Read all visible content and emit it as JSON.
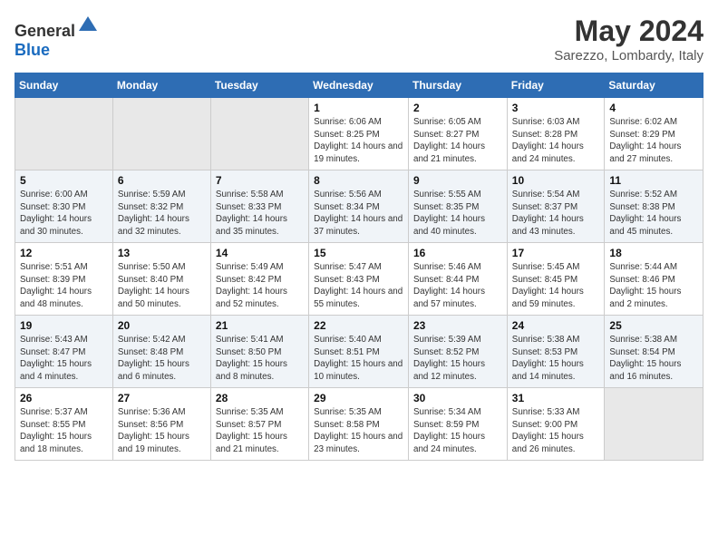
{
  "header": {
    "logo_general": "General",
    "logo_blue": "Blue",
    "title": "May 2024",
    "subtitle": "Sarezzo, Lombardy, Italy"
  },
  "weekdays": [
    "Sunday",
    "Monday",
    "Tuesday",
    "Wednesday",
    "Thursday",
    "Friday",
    "Saturday"
  ],
  "weeks": [
    [
      {
        "day": "",
        "info": ""
      },
      {
        "day": "",
        "info": ""
      },
      {
        "day": "",
        "info": ""
      },
      {
        "day": "1",
        "info": "Sunrise: 6:06 AM\nSunset: 8:25 PM\nDaylight: 14 hours\nand 19 minutes."
      },
      {
        "day": "2",
        "info": "Sunrise: 6:05 AM\nSunset: 8:27 PM\nDaylight: 14 hours\nand 21 minutes."
      },
      {
        "day": "3",
        "info": "Sunrise: 6:03 AM\nSunset: 8:28 PM\nDaylight: 14 hours\nand 24 minutes."
      },
      {
        "day": "4",
        "info": "Sunrise: 6:02 AM\nSunset: 8:29 PM\nDaylight: 14 hours\nand 27 minutes."
      }
    ],
    [
      {
        "day": "5",
        "info": "Sunrise: 6:00 AM\nSunset: 8:30 PM\nDaylight: 14 hours\nand 30 minutes."
      },
      {
        "day": "6",
        "info": "Sunrise: 5:59 AM\nSunset: 8:32 PM\nDaylight: 14 hours\nand 32 minutes."
      },
      {
        "day": "7",
        "info": "Sunrise: 5:58 AM\nSunset: 8:33 PM\nDaylight: 14 hours\nand 35 minutes."
      },
      {
        "day": "8",
        "info": "Sunrise: 5:56 AM\nSunset: 8:34 PM\nDaylight: 14 hours\nand 37 minutes."
      },
      {
        "day": "9",
        "info": "Sunrise: 5:55 AM\nSunset: 8:35 PM\nDaylight: 14 hours\nand 40 minutes."
      },
      {
        "day": "10",
        "info": "Sunrise: 5:54 AM\nSunset: 8:37 PM\nDaylight: 14 hours\nand 43 minutes."
      },
      {
        "day": "11",
        "info": "Sunrise: 5:52 AM\nSunset: 8:38 PM\nDaylight: 14 hours\nand 45 minutes."
      }
    ],
    [
      {
        "day": "12",
        "info": "Sunrise: 5:51 AM\nSunset: 8:39 PM\nDaylight: 14 hours\nand 48 minutes."
      },
      {
        "day": "13",
        "info": "Sunrise: 5:50 AM\nSunset: 8:40 PM\nDaylight: 14 hours\nand 50 minutes."
      },
      {
        "day": "14",
        "info": "Sunrise: 5:49 AM\nSunset: 8:42 PM\nDaylight: 14 hours\nand 52 minutes."
      },
      {
        "day": "15",
        "info": "Sunrise: 5:47 AM\nSunset: 8:43 PM\nDaylight: 14 hours\nand 55 minutes."
      },
      {
        "day": "16",
        "info": "Sunrise: 5:46 AM\nSunset: 8:44 PM\nDaylight: 14 hours\nand 57 minutes."
      },
      {
        "day": "17",
        "info": "Sunrise: 5:45 AM\nSunset: 8:45 PM\nDaylight: 14 hours\nand 59 minutes."
      },
      {
        "day": "18",
        "info": "Sunrise: 5:44 AM\nSunset: 8:46 PM\nDaylight: 15 hours\nand 2 minutes."
      }
    ],
    [
      {
        "day": "19",
        "info": "Sunrise: 5:43 AM\nSunset: 8:47 PM\nDaylight: 15 hours\nand 4 minutes."
      },
      {
        "day": "20",
        "info": "Sunrise: 5:42 AM\nSunset: 8:48 PM\nDaylight: 15 hours\nand 6 minutes."
      },
      {
        "day": "21",
        "info": "Sunrise: 5:41 AM\nSunset: 8:50 PM\nDaylight: 15 hours\nand 8 minutes."
      },
      {
        "day": "22",
        "info": "Sunrise: 5:40 AM\nSunset: 8:51 PM\nDaylight: 15 hours\nand 10 minutes."
      },
      {
        "day": "23",
        "info": "Sunrise: 5:39 AM\nSunset: 8:52 PM\nDaylight: 15 hours\nand 12 minutes."
      },
      {
        "day": "24",
        "info": "Sunrise: 5:38 AM\nSunset: 8:53 PM\nDaylight: 15 hours\nand 14 minutes."
      },
      {
        "day": "25",
        "info": "Sunrise: 5:38 AM\nSunset: 8:54 PM\nDaylight: 15 hours\nand 16 minutes."
      }
    ],
    [
      {
        "day": "26",
        "info": "Sunrise: 5:37 AM\nSunset: 8:55 PM\nDaylight: 15 hours\nand 18 minutes."
      },
      {
        "day": "27",
        "info": "Sunrise: 5:36 AM\nSunset: 8:56 PM\nDaylight: 15 hours\nand 19 minutes."
      },
      {
        "day": "28",
        "info": "Sunrise: 5:35 AM\nSunset: 8:57 PM\nDaylight: 15 hours\nand 21 minutes."
      },
      {
        "day": "29",
        "info": "Sunrise: 5:35 AM\nSunset: 8:58 PM\nDaylight: 15 hours\nand 23 minutes."
      },
      {
        "day": "30",
        "info": "Sunrise: 5:34 AM\nSunset: 8:59 PM\nDaylight: 15 hours\nand 24 minutes."
      },
      {
        "day": "31",
        "info": "Sunrise: 5:33 AM\nSunset: 9:00 PM\nDaylight: 15 hours\nand 26 minutes."
      },
      {
        "day": "",
        "info": ""
      }
    ]
  ]
}
